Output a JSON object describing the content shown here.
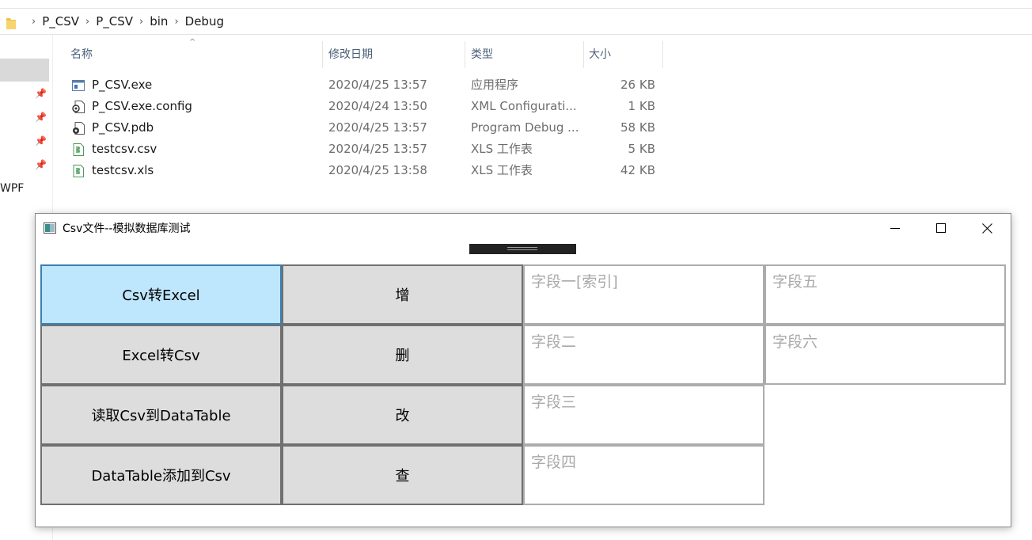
{
  "explorer": {
    "breadcrumb": [
      "P_CSV",
      "P_CSV",
      "bin",
      "Debug"
    ],
    "nav": {
      "wpf_label": "WPF"
    },
    "columns": {
      "name": "名称",
      "date": "修改日期",
      "type": "类型",
      "size": "大小"
    },
    "files": [
      {
        "name": "P_CSV.exe",
        "date": "2020/4/25 13:57",
        "type": "应用程序",
        "size": "26 KB",
        "icon": "application-icon"
      },
      {
        "name": "P_CSV.exe.config",
        "date": "2020/4/24 13:50",
        "type": "XML Configurati...",
        "size": "1 KB",
        "icon": "config-file-icon"
      },
      {
        "name": "P_CSV.pdb",
        "date": "2020/4/25 13:57",
        "type": "Program Debug ...",
        "size": "58 KB",
        "icon": "debug-file-icon"
      },
      {
        "name": "testcsv.csv",
        "date": "2020/4/25 13:57",
        "type": "XLS 工作表",
        "size": "5 KB",
        "icon": "spreadsheet-icon"
      },
      {
        "name": "testcsv.xls",
        "date": "2020/4/25 13:58",
        "type": "XLS 工作表",
        "size": "42 KB",
        "icon": "spreadsheet-icon"
      }
    ]
  },
  "window": {
    "title": "Csv文件--模拟数据库测试",
    "buttons": {
      "csv_to_excel": "Csv转Excel",
      "excel_to_csv": "Excel转Csv",
      "read_csv": "读取Csv到DataTable",
      "add_datatable": "DataTable添加到Csv",
      "add": "增",
      "delete": "删",
      "update": "改",
      "query": "查"
    },
    "fields": {
      "f1": "字段一[索引]",
      "f2": "字段二",
      "f3": "字段三",
      "f4": "字段四",
      "f5": "字段五",
      "f6": "字段六"
    }
  },
  "colors": {
    "button_face": "#dddddd",
    "button_hover": "#bee6fd",
    "placeholder": "#a9a9a9",
    "header_text": "#4c607a"
  }
}
